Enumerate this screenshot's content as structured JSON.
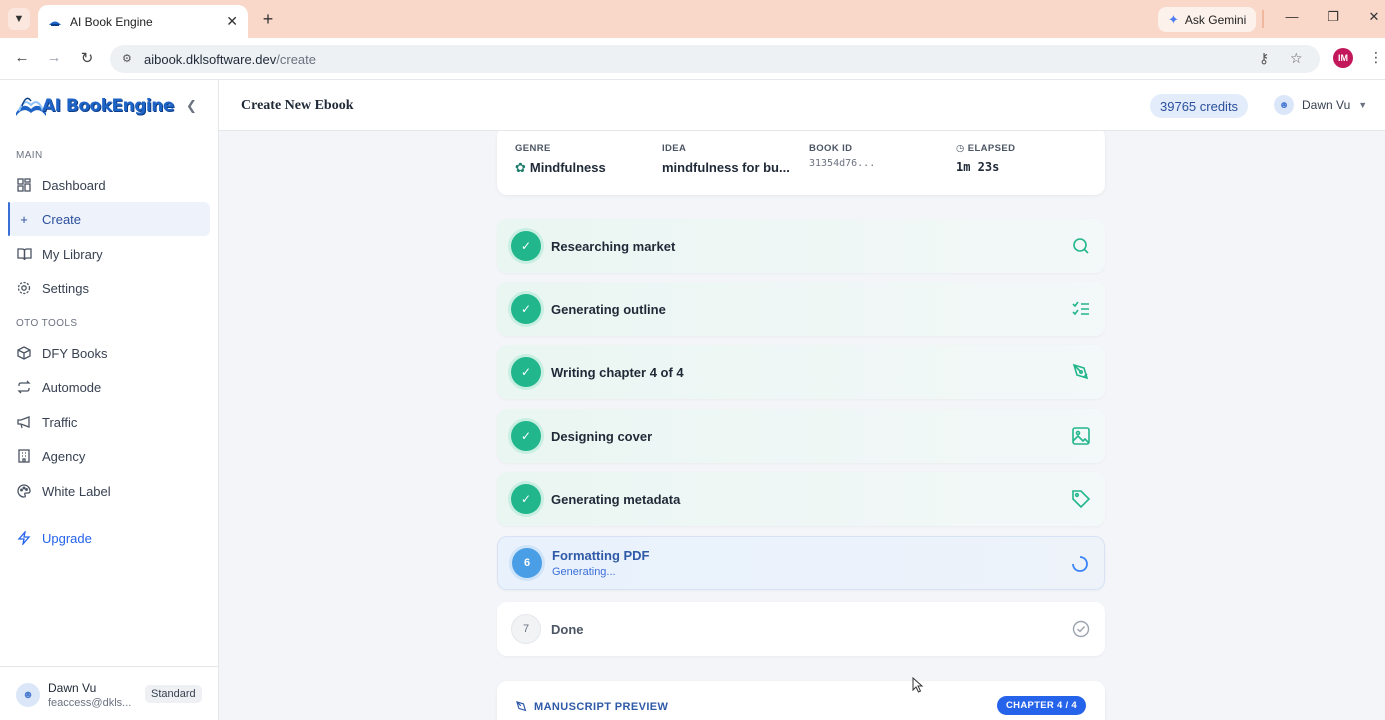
{
  "browser": {
    "tab_title": "AI Book Engine",
    "gemini_label": "Ask Gemini",
    "url_host": "aibook.dklsoftware.dev",
    "url_path": "/create",
    "profile_initials": "IM"
  },
  "sidebar": {
    "brand": "AI BookEngine",
    "sections": {
      "main": "MAIN",
      "oto": "OTO TOOLS"
    },
    "items": {
      "dashboard": "Dashboard",
      "create": "Create",
      "library": "My Library",
      "settings": "Settings",
      "dfy": "DFY Books",
      "automode": "Automode",
      "traffic": "Traffic",
      "agency": "Agency",
      "white_label": "White Label",
      "upgrade": "Upgrade"
    },
    "footer": {
      "name": "Dawn Vu",
      "email": "feaccess@dkls...",
      "plan": "Standard"
    }
  },
  "header": {
    "title": "Create New Ebook",
    "credits": "39765 credits",
    "user": "Dawn Vu"
  },
  "info": {
    "genre_label": "GENRE",
    "genre": "Mindfulness",
    "idea_label": "IDEA",
    "idea": "mindfulness for bu...",
    "book_id_label": "BOOK ID",
    "book_id": "31354d76...",
    "elapsed_label": "ELAPSED",
    "elapsed": "1m 23s"
  },
  "steps": [
    {
      "status": "done",
      "name": "Researching market",
      "icon": "search-icon"
    },
    {
      "status": "done",
      "name": "Generating outline",
      "icon": "list-checks-icon"
    },
    {
      "status": "done",
      "name": "Writing chapter 4 of 4",
      "icon": "pen-tool-icon"
    },
    {
      "status": "done",
      "name": "Designing cover",
      "icon": "image-icon"
    },
    {
      "status": "done",
      "name": "Generating metadata",
      "icon": "tag-icon"
    },
    {
      "status": "active",
      "number": "6",
      "name": "Formatting PDF",
      "sub": "Generating...",
      "icon": "spinner-icon"
    },
    {
      "status": "pending",
      "number": "7",
      "name": "Done",
      "icon": "check-circle-icon"
    }
  ],
  "preview": {
    "label": "MANUSCRIPT PREVIEW",
    "chapter_badge": "CHAPTER 4 / 4"
  },
  "colors": {
    "accent": "#2563eb",
    "done_green": "#22b68c",
    "active_blue": "#4a9ee6",
    "tabbar_peach": "#f9d8c9"
  }
}
